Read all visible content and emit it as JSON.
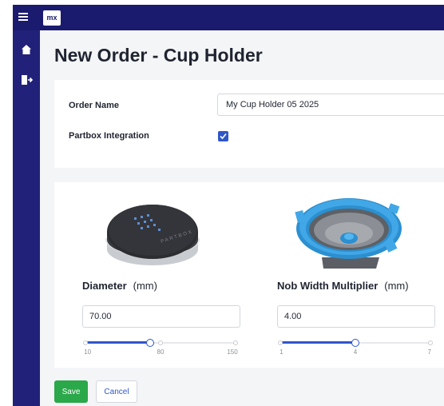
{
  "app": {
    "logo_text": "mx"
  },
  "header": {
    "menu_icon": "hamburger-menu-icon"
  },
  "sidebar": {
    "items": [
      {
        "icon": "home-icon"
      },
      {
        "icon": "sign-out-icon"
      }
    ]
  },
  "page": {
    "title": "New Order - Cup Holder"
  },
  "form": {
    "order_name": {
      "label": "Order Name",
      "value": "My Cup Holder 05 2025"
    },
    "partbox": {
      "label": "Partbox Integration",
      "checked": true
    }
  },
  "params": [
    {
      "label": "Diameter",
      "unit": "(mm)",
      "value": "70.00",
      "image": "cup-holder-base-image",
      "slider": {
        "min": "10",
        "mid": "80",
        "max": "150",
        "current": 70
      }
    },
    {
      "label": "Nob Width Multiplier",
      "unit": "(mm)",
      "value": "4.00",
      "image": "cup-holder-insert-image",
      "slider": {
        "min": "1",
        "mid": "4",
        "max": "7",
        "current": 4
      }
    }
  ],
  "actions": {
    "save_label": "Save",
    "cancel_label": "Cancel"
  },
  "colors": {
    "topbar": "#1a1a6e",
    "sidebar": "#21217a",
    "accent": "#2f57c9",
    "save": "#2aa84a",
    "background": "#f4f5f7"
  }
}
